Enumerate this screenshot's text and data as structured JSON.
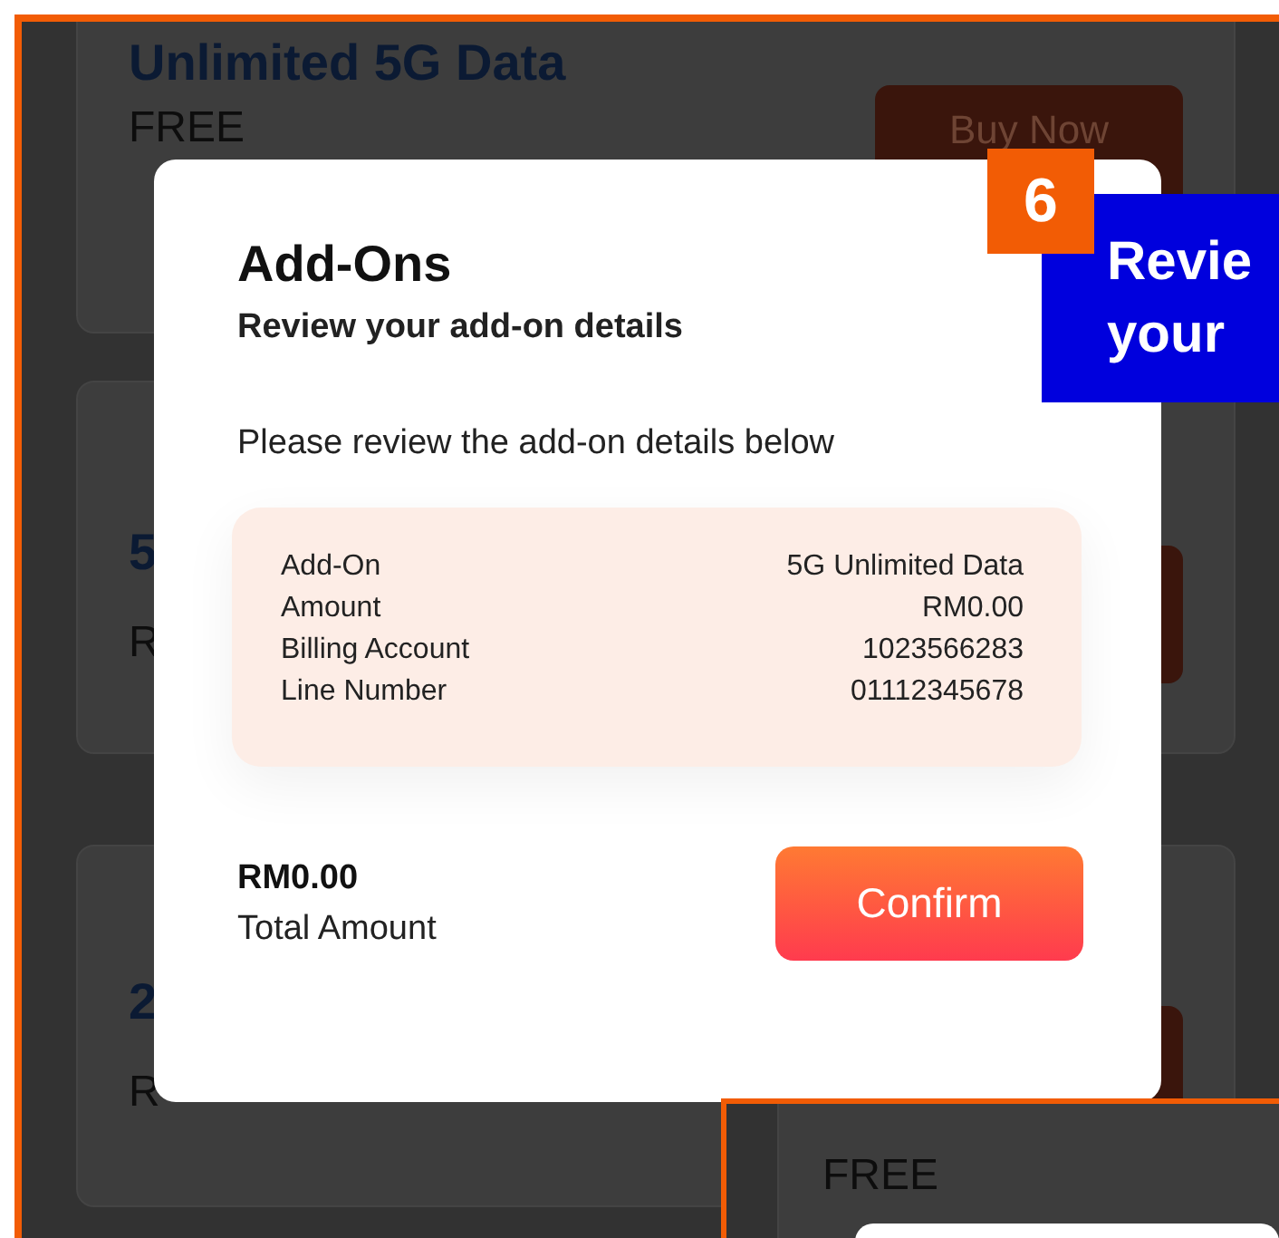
{
  "background_cards": [
    {
      "title": "Unlimited 5G Data",
      "price": "FREE",
      "button": "Buy Now"
    },
    {
      "title": "5",
      "price": "R"
    },
    {
      "title": "2",
      "price": "R"
    }
  ],
  "step_badge": "6",
  "callout": {
    "lines": [
      "Revie",
      "your"
    ]
  },
  "dialog": {
    "title": "Add-Ons",
    "subtitle": "Review your add-on details",
    "intro": "Please review the add-on details below",
    "details": [
      {
        "label": "Add-On",
        "value": "5G Unlimited Data"
      },
      {
        "label": "Amount",
        "value": "RM0.00"
      },
      {
        "label": "Billing Account",
        "value": "1023566283"
      },
      {
        "label": "Line Number",
        "value": "01112345678"
      }
    ],
    "total": {
      "amount": "RM0.00",
      "label": "Total Amount"
    },
    "confirm_button": "Confirm"
  },
  "inset": {
    "price": "FREE"
  }
}
